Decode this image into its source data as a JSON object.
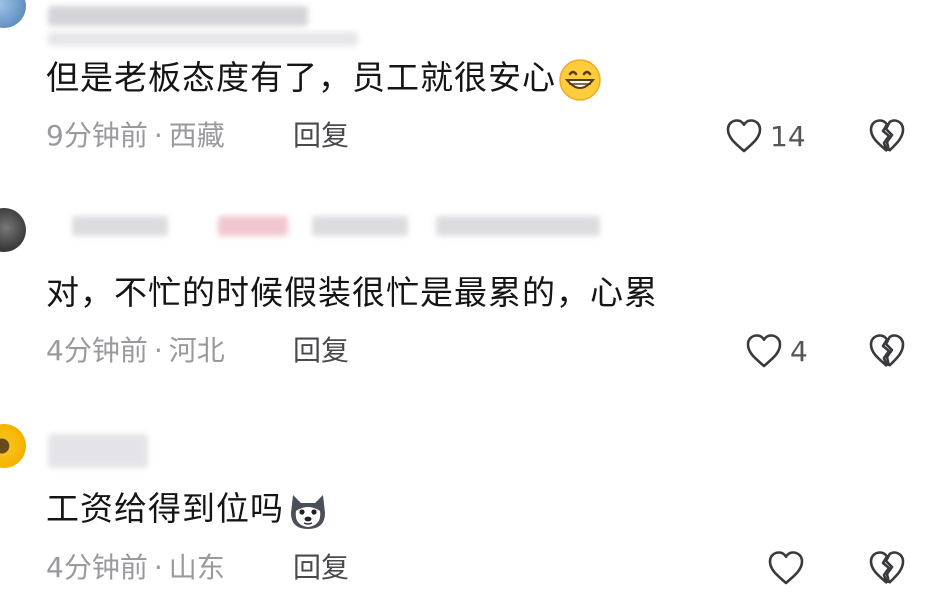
{
  "comments": [
    {
      "text": "但是老板态度有了，员工就很安心",
      "emoji": "grinning-face-emoji",
      "time": "9分钟前",
      "location": "西藏",
      "reply_label": "回复",
      "like_count": "14",
      "avatar": "blue-avatar"
    },
    {
      "text": "对，不忙的时候假装很忙是最累的，心累",
      "time": "4分钟前",
      "location": "河北",
      "reply_label": "回复",
      "like_count": "4",
      "avatar": "dark-avatar"
    },
    {
      "text": "工资给得到位吗",
      "emoji": "husky-dog-emoji",
      "time": "4分钟前",
      "location": "山东",
      "reply_label": "回复",
      "like_count": "",
      "avatar": "sunflower-avatar"
    }
  ],
  "separator": "·",
  "icons": {
    "like": "heart-outline-icon",
    "dislike": "broken-heart-icon"
  },
  "colors": {
    "text": "#151515",
    "meta": "#9a9a9e",
    "icon": "#3a3a3e"
  }
}
